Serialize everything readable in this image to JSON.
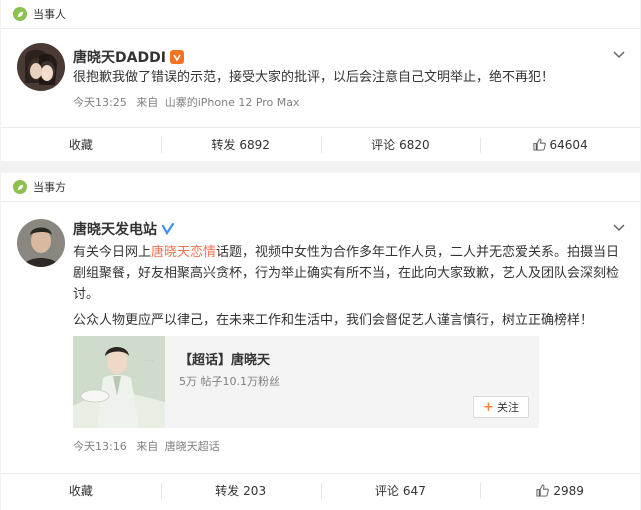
{
  "post1": {
    "tag": "当事人",
    "username": "唐晓天DADDI",
    "text": "很抱歉我做了错误的示范，接受大家的批评，以后会注意自己文明举止，绝不再犯！",
    "time": "今天13:25",
    "source_prefix": "来自",
    "source": "山寨的iPhone 12 Pro Max",
    "actions": {
      "collect": "收藏",
      "repost_label": "转发",
      "repost_count": "6892",
      "comment_label": "评论",
      "comment_count": "6820",
      "like_count": "64604"
    }
  },
  "post2": {
    "tag": "当事方",
    "username": "唐晓天发电站",
    "text_before": "有关今日网上",
    "text_highlight": "唐晓天恋情",
    "text_after": "话题，视频中女性为合作多年工作人员，二人并无恋爱关系。拍摄当日剧组聚餐，好友相聚高兴贪杯，行为举止确实有所不当，在此向大家致歉，艺人及团队会深刻检讨。",
    "text_second": "公众人物更应严以律己，在未来工作和生活中，我们会督促艺人谨言慎行，树立正确榜样！",
    "topic": {
      "title": "【超话】唐晓天",
      "stats": "5万 帖子10.1万粉丝",
      "follow": "关注"
    },
    "time": "今天13:16",
    "source_prefix": "来自",
    "source": "唐晓天超话",
    "actions": {
      "collect": "收藏",
      "repost_label": "转发",
      "repost_count": "203",
      "comment_label": "评论",
      "comment_count": "647",
      "like_count": "2989"
    }
  },
  "colors": {
    "tag_icon": "#8cc04f",
    "highlight": "#eb7350",
    "verify_orange": "#f7731e",
    "verify_blue": "#3f8ff2"
  },
  "icons": [
    "leaf-icon",
    "chevron-down-icon",
    "verified-orange-icon",
    "verified-blue-icon",
    "thumbs-up-icon",
    "plus-icon"
  ]
}
